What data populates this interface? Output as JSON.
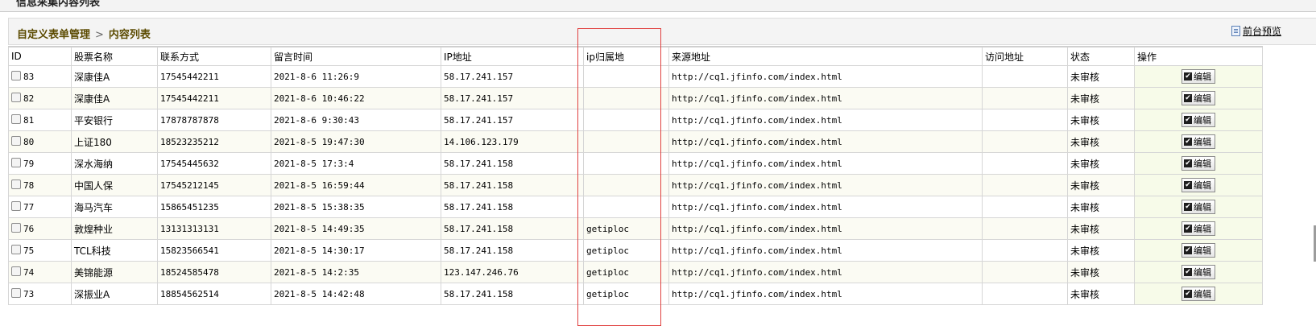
{
  "window": {
    "title": "信息采集内容列表"
  },
  "breadcrumb": {
    "root": "自定义表单管理",
    "separator": ">",
    "current": "内容列表"
  },
  "toolbar": {
    "preview_label": "前台预览"
  },
  "table": {
    "headers": [
      "ID",
      "股票名称",
      "联系方式",
      "留言时间",
      "IP地址",
      "ip归属地",
      "来源地址",
      "访问地址",
      "状态",
      "操作"
    ],
    "edit_label": "编辑",
    "rows": [
      {
        "id": "83",
        "name": "深康佳A",
        "phone": "17545442211",
        "time": "2021-8-6 11:26:9",
        "ip": "58.17.241.157",
        "loc": "",
        "source": "http://cq1.jfinfo.com/index.html",
        "visit": "",
        "status": "未审核"
      },
      {
        "id": "82",
        "name": "深康佳A",
        "phone": "17545442211",
        "time": "2021-8-6 10:46:22",
        "ip": "58.17.241.157",
        "loc": "",
        "source": "http://cq1.jfinfo.com/index.html",
        "visit": "",
        "status": "未审核"
      },
      {
        "id": "81",
        "name": "平安银行",
        "phone": "17878787878",
        "time": "2021-8-6 9:30:43",
        "ip": "58.17.241.157",
        "loc": "",
        "source": "http://cq1.jfinfo.com/index.html",
        "visit": "",
        "status": "未审核"
      },
      {
        "id": "80",
        "name": "上证180",
        "phone": "18523235212",
        "time": "2021-8-5 19:47:30",
        "ip": "14.106.123.179",
        "loc": "",
        "source": "http://cq1.jfinfo.com/index.html",
        "visit": "",
        "status": "未审核"
      },
      {
        "id": "79",
        "name": "深水海纳",
        "phone": "17545445632",
        "time": "2021-8-5 17:3:4",
        "ip": "58.17.241.158",
        "loc": "",
        "source": "http://cq1.jfinfo.com/index.html",
        "visit": "",
        "status": "未审核"
      },
      {
        "id": "78",
        "name": "中国人保",
        "phone": "17545212145",
        "time": "2021-8-5 16:59:44",
        "ip": "58.17.241.158",
        "loc": "",
        "source": "http://cq1.jfinfo.com/index.html",
        "visit": "",
        "status": "未审核"
      },
      {
        "id": "77",
        "name": "海马汽车",
        "phone": "15865451235",
        "time": "2021-8-5 15:38:35",
        "ip": "58.17.241.158",
        "loc": "",
        "source": "http://cq1.jfinfo.com/index.html",
        "visit": "",
        "status": "未审核"
      },
      {
        "id": "76",
        "name": "敦煌种业",
        "phone": "13131313131",
        "time": "2021-8-5 14:49:35",
        "ip": "58.17.241.158",
        "loc": "getiploc",
        "source": "http://cq1.jfinfo.com/index.html",
        "visit": "",
        "status": "未审核"
      },
      {
        "id": "75",
        "name": "TCL科技",
        "phone": "15823566541",
        "time": "2021-8-5 14:30:17",
        "ip": "58.17.241.158",
        "loc": "getiploc",
        "source": "http://cq1.jfinfo.com/index.html",
        "visit": "",
        "status": "未审核"
      },
      {
        "id": "74",
        "name": "美锦能源",
        "phone": "18524585478",
        "time": "2021-8-5 14:2:35",
        "ip": "123.147.246.76",
        "loc": "getiploc",
        "source": "http://cq1.jfinfo.com/index.html",
        "visit": "",
        "status": "未审核"
      },
      {
        "id": "73",
        "name": "深振业A",
        "phone": "18854562514",
        "time": "2021-8-5 14:42:48",
        "ip": "58.17.241.158",
        "loc": "getiploc",
        "source": "http://cq1.jfinfo.com/index.html",
        "visit": "",
        "status": "未审核"
      }
    ]
  }
}
